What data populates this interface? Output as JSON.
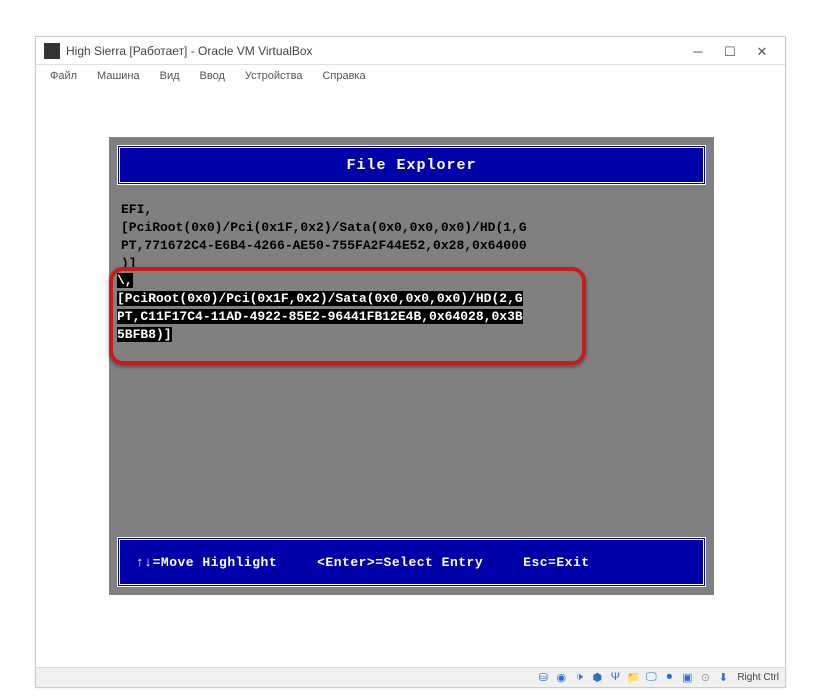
{
  "window": {
    "title": "High Sierra [Работает] - Oracle VM VirtualBox"
  },
  "menu": {
    "items": [
      "Файл",
      "Машина",
      "Вид",
      "Ввод",
      "Устройства",
      "Справка"
    ]
  },
  "bios": {
    "header": "File Explorer",
    "entry1_line1": "EFI,",
    "entry1_line2": "[PciRoot(0x0)/Pci(0x1F,0x2)/Sata(0x0,0x0,0x0)/HD(1,G",
    "entry1_line3": "PT,771672C4-E6B4-4266-AE50-755FA2F44E52,0x28,0x64000",
    "entry1_line4": ")]",
    "entry2_line1": "\\,",
    "entry2_line2": "[PciRoot(0x0)/Pci(0x1F,0x2)/Sata(0x0,0x0,0x0)/HD(2,G",
    "entry2_line3": "PT,C11F17C4-11AD-4922-85E2-96441FB12E4B,0x64028,0x3B",
    "entry2_line4": "5BFB8)]",
    "footer_move": "↑↓=Move Highlight",
    "footer_select": "<Enter>=Select Entry",
    "footer_exit": "Esc=Exit"
  },
  "status": {
    "host_key": "Right Ctrl"
  }
}
